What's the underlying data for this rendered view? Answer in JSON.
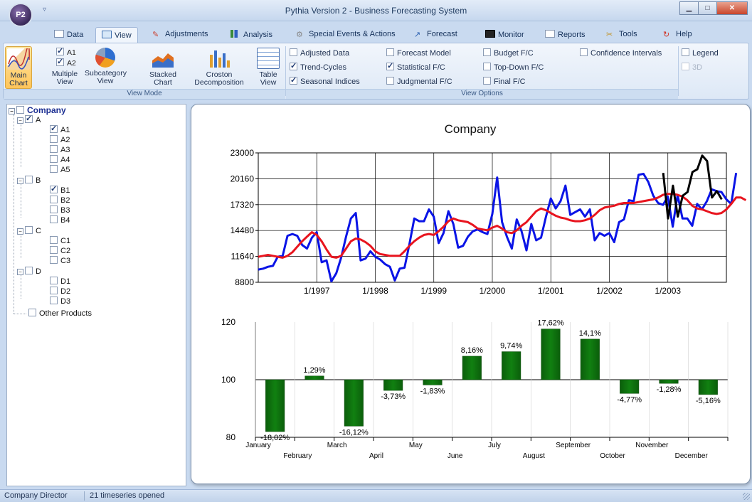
{
  "window": {
    "title": "Pythia Version 2 - Business Forecasting System",
    "orb_label": "P2",
    "qat_glyph": "▿"
  },
  "tabs": [
    {
      "label": "Data",
      "icon": "data-icon"
    },
    {
      "label": "View",
      "icon": "view-icon"
    },
    {
      "label": "Adjustments",
      "icon": "adjustments-icon"
    },
    {
      "label": "Analysis",
      "icon": "analysis-icon"
    },
    {
      "label": "Special Events & Actions",
      "icon": "special-events-icon"
    },
    {
      "label": "Forecast",
      "icon": "forecast-icon"
    },
    {
      "label": "Monitor",
      "icon": "monitor-icon"
    },
    {
      "label": "Reports",
      "icon": "reports-icon"
    },
    {
      "label": "Tools",
      "icon": "tools-icon"
    },
    {
      "label": "Help",
      "icon": "help-icon"
    }
  ],
  "active_tab": "View",
  "ribbon": {
    "view_mode": {
      "group_label": "View Mode",
      "main_chart": "Main Chart",
      "multiple_view": "Multiple View",
      "multiple_checks": [
        "A1",
        "A2"
      ],
      "subcategory_view": "Subcategory View",
      "stacked_chart": "Stacked Chart",
      "croston": "Croston Decomposition",
      "table_view": "Table View"
    },
    "view_options": {
      "group_label": "View Options",
      "options": [
        {
          "label": "Adjusted Data",
          "checked": false
        },
        {
          "label": "Trend-Cycles",
          "checked": true
        },
        {
          "label": "Seasonal Indices",
          "checked": true
        },
        {
          "label": "Forecast Model",
          "checked": false
        },
        {
          "label": "Statistical F/C",
          "checked": true
        },
        {
          "label": "Judgmental F/C",
          "checked": false
        },
        {
          "label": "Budget F/C",
          "checked": false
        },
        {
          "label": "Top-Down F/C",
          "checked": false
        },
        {
          "label": "Final F/C",
          "checked": false
        },
        {
          "label": "Confidence Intervals",
          "checked": false
        },
        {
          "label": "Legend",
          "checked": false
        },
        {
          "label": "3D",
          "checked": false,
          "disabled": true
        }
      ]
    }
  },
  "tree": {
    "root": "Company",
    "groups": [
      {
        "label": "A",
        "checked": true,
        "items": [
          {
            "label": "A1",
            "checked": true
          },
          {
            "label": "A2",
            "checked": false
          },
          {
            "label": "A3",
            "checked": false
          },
          {
            "label": "A4",
            "checked": false
          },
          {
            "label": "A5",
            "checked": false
          }
        ]
      },
      {
        "label": "B",
        "checked": false,
        "items": [
          {
            "label": "B1",
            "checked": true
          },
          {
            "label": "B2",
            "checked": false
          },
          {
            "label": "B3",
            "checked": false
          },
          {
            "label": "B4",
            "checked": false
          }
        ]
      },
      {
        "label": "C",
        "checked": false,
        "items": [
          {
            "label": "C1",
            "checked": false
          },
          {
            "label": "C2",
            "checked": false
          },
          {
            "label": "C3",
            "checked": false
          }
        ]
      },
      {
        "label": "D",
        "checked": false,
        "items": [
          {
            "label": "D1",
            "checked": false
          },
          {
            "label": "D2",
            "checked": false
          },
          {
            "label": "D3",
            "checked": false
          }
        ]
      }
    ],
    "other": "Other Products"
  },
  "status": {
    "user": "Company Director",
    "info": "21 timeseries opened"
  },
  "colors": {
    "actual": "#0a14e6",
    "trend": "#e8141e",
    "forecast": "#000000",
    "seasonal_bar": "#118011"
  },
  "chart_data": [
    {
      "type": "line",
      "title": "Company",
      "ylim": [
        8800,
        23000
      ],
      "yticks": [
        8800,
        11640,
        14480,
        17320,
        20160,
        23000
      ],
      "xlim": [
        1996.0,
        2004.0
      ],
      "xticks": [
        {
          "x": 1997.0,
          "label": "1/1997"
        },
        {
          "x": 1998.0,
          "label": "1/1998"
        },
        {
          "x": 1999.0,
          "label": "1/1999"
        },
        {
          "x": 2000.0,
          "label": "1/2000"
        },
        {
          "x": 2001.0,
          "label": "1/2001"
        },
        {
          "x": 2002.0,
          "label": "1/2002"
        },
        {
          "x": 2003.0,
          "label": "1/2003"
        }
      ],
      "grid": true,
      "series": [
        {
          "key": "actual",
          "x_start": 1996.0,
          "x_step": 0.08333,
          "values": [
            10200,
            10300,
            10500,
            10600,
            11600,
            11700,
            13900,
            14100,
            13900,
            12900,
            12500,
            13700,
            14300,
            11000,
            11200,
            8900,
            9800,
            11500,
            13800,
            15800,
            16400,
            11200,
            11400,
            12200,
            11600,
            11300,
            10800,
            10500,
            9000,
            10300,
            10400,
            13000,
            15800,
            15500,
            15500,
            16800,
            16000,
            13100,
            14200,
            16600,
            15200,
            12600,
            12800,
            13800,
            14400,
            14600,
            14300,
            14100,
            16300,
            20300,
            15400,
            13800,
            12500,
            15700,
            14400,
            12300,
            15200,
            13400,
            13700,
            16000,
            18000,
            16900,
            17700,
            19400,
            16200,
            16500,
            16800,
            16000,
            16800,
            13400,
            14200,
            13900,
            14200,
            13200,
            15400,
            15700,
            17800,
            17700,
            20600,
            20700,
            19800,
            18300,
            17500,
            17300,
            18200,
            14900,
            18400,
            15800,
            15800,
            15000,
            17400,
            16800,
            17700,
            19000,
            18800,
            18700,
            17900,
            17400,
            20800
          ]
        },
        {
          "key": "trend",
          "x_start": 1996.0,
          "x_step": 0.08333,
          "values": [
            11600,
            11700,
            11800,
            11700,
            11600,
            11500,
            11700,
            12100,
            12700,
            13300,
            13800,
            14300,
            14000,
            13300,
            12400,
            11600,
            11500,
            11700,
            12500,
            13300,
            13600,
            13500,
            13200,
            12800,
            12200,
            11900,
            11800,
            11700,
            11700,
            11700,
            12200,
            12800,
            13300,
            13700,
            14000,
            14100,
            14000,
            14400,
            14900,
            15500,
            15800,
            15600,
            15500,
            15400,
            15100,
            14700,
            14600,
            14500,
            14800,
            15000,
            14700,
            14300,
            14200,
            14500,
            15000,
            15400,
            16000,
            16600,
            16900,
            16700,
            16400,
            16100,
            15900,
            15800,
            15600,
            15500,
            15500,
            15600,
            15800,
            16200,
            16700,
            17000,
            17100,
            17200,
            17400,
            17500,
            17500,
            17500,
            17600,
            17700,
            17800,
            17900,
            18100,
            18400,
            18500,
            18500,
            18400,
            18200,
            17800,
            17200,
            16900,
            16800,
            16600,
            16400,
            16300,
            16400,
            16800,
            17400,
            18100,
            18100,
            17800
          ]
        },
        {
          "key": "forecast",
          "x_start": 2002.92,
          "x_step": 0.08333,
          "values": [
            20800,
            15800,
            19400,
            16000,
            18300,
            18700,
            20900,
            21200,
            22700,
            22100,
            18100,
            18800,
            17900
          ]
        }
      ]
    },
    {
      "type": "bar",
      "ylim": [
        80,
        120
      ],
      "yticks": [
        80,
        100,
        120
      ],
      "baseline": 100,
      "categories": [
        "January",
        "February",
        "March",
        "April",
        "May",
        "June",
        "July",
        "August",
        "September",
        "October",
        "November",
        "December"
      ],
      "values": [
        81.98,
        101.29,
        83.88,
        96.27,
        98.17,
        108.16,
        109.74,
        117.62,
        114.1,
        95.23,
        98.72,
        94.84
      ],
      "data_labels": [
        "-18,02%",
        "1,29%",
        "-16,12%",
        "-3,73%",
        "-1,83%",
        "8,16%",
        "9,74%",
        "17,62%",
        "14,1%",
        "-4,77%",
        "-1,28%",
        "-5,16%"
      ]
    }
  ]
}
